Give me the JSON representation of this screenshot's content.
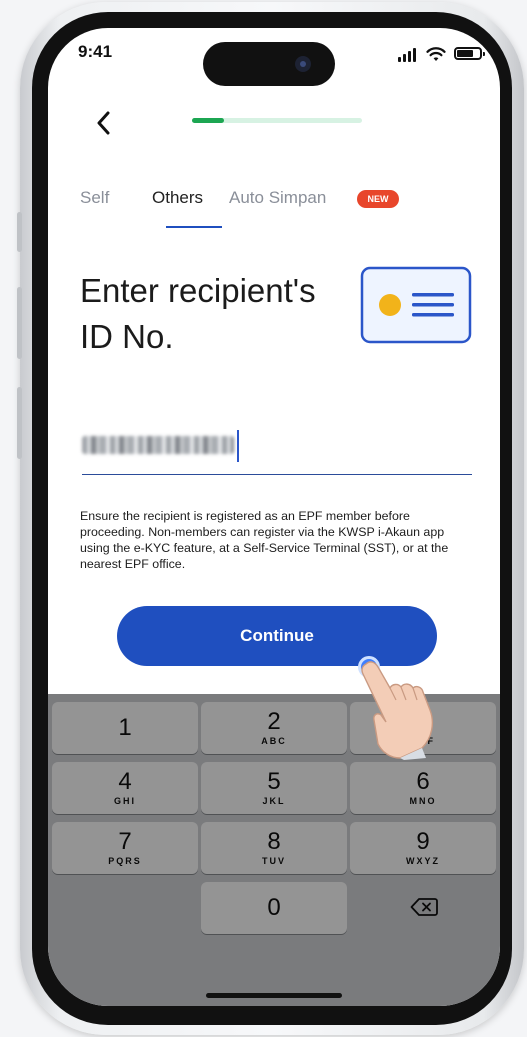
{
  "status_bar": {
    "time": "9:41"
  },
  "progress": {
    "fraction": 0.19,
    "fill_color": "#1ca652",
    "track_color": "#d7f2e3"
  },
  "tabs": [
    {
      "label": "Self",
      "active": false
    },
    {
      "label": "Others",
      "active": true
    },
    {
      "label": "Auto Simpan",
      "active": false,
      "badge": "NEW"
    }
  ],
  "title_line1": "Enter recipient's",
  "title_line2": "ID No.",
  "id_input": {
    "value_state": "blurred"
  },
  "notice": "Ensure the recipient is registered as an EPF member before proceeding. Non-members can register via the KWSP i-Akaun app using the e-KYC feature, at a Self-Service Terminal (SST), or at the nearest EPF office.",
  "continue_label": "Continue",
  "keypad": {
    "keys": [
      {
        "num": "1",
        "letters": ""
      },
      {
        "num": "2",
        "letters": "ABC"
      },
      {
        "num": "3",
        "letters": "DEF"
      },
      {
        "num": "4",
        "letters": "GHI"
      },
      {
        "num": "5",
        "letters": "JKL"
      },
      {
        "num": "6",
        "letters": "MNO"
      },
      {
        "num": "7",
        "letters": "PQRS"
      },
      {
        "num": "8",
        "letters": "TUV"
      },
      {
        "num": "9",
        "letters": "WXYZ"
      },
      {
        "num": "0",
        "letters": ""
      }
    ],
    "backspace_icon": "backspace-icon"
  },
  "colors": {
    "primary": "#1f4fbf",
    "accent_green": "#1ca652",
    "badge": "#e8462b"
  }
}
